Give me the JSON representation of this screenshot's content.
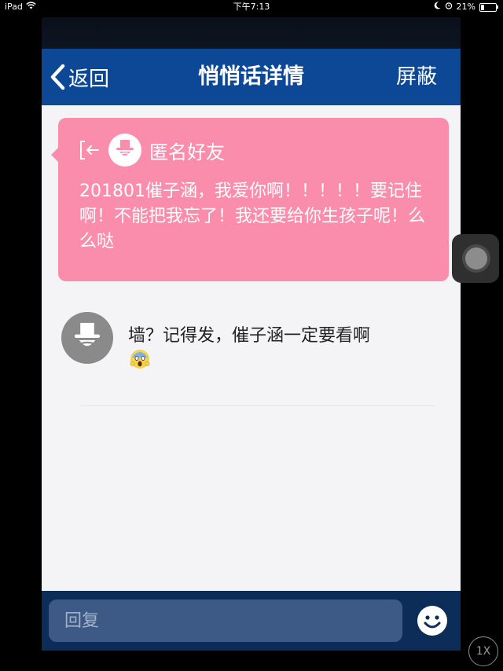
{
  "status_bar": {
    "device": "iPad",
    "time": "下午7:13",
    "battery": "21%",
    "battery_level": 0.21
  },
  "nav": {
    "back_label": "返回",
    "title": "悄悄话详情",
    "block_label": "屏蔽"
  },
  "message": {
    "sender": "匿名好友",
    "text": "201801催子涵，我爱你啊！！！！！要记住啊！不能把我忘了！我还要给你生孩子呢！么么哒",
    "bubble_color": "#fa8cac"
  },
  "comment": {
    "text": "墙？记得发，催子涵一定要看啊"
  },
  "reply": {
    "placeholder": "回复"
  },
  "zoom_indicator": "1X",
  "colors": {
    "nav_blue": "#0d4897",
    "reply_bar": "#0b2d57",
    "emoji_yellow": "#f5d44a"
  }
}
